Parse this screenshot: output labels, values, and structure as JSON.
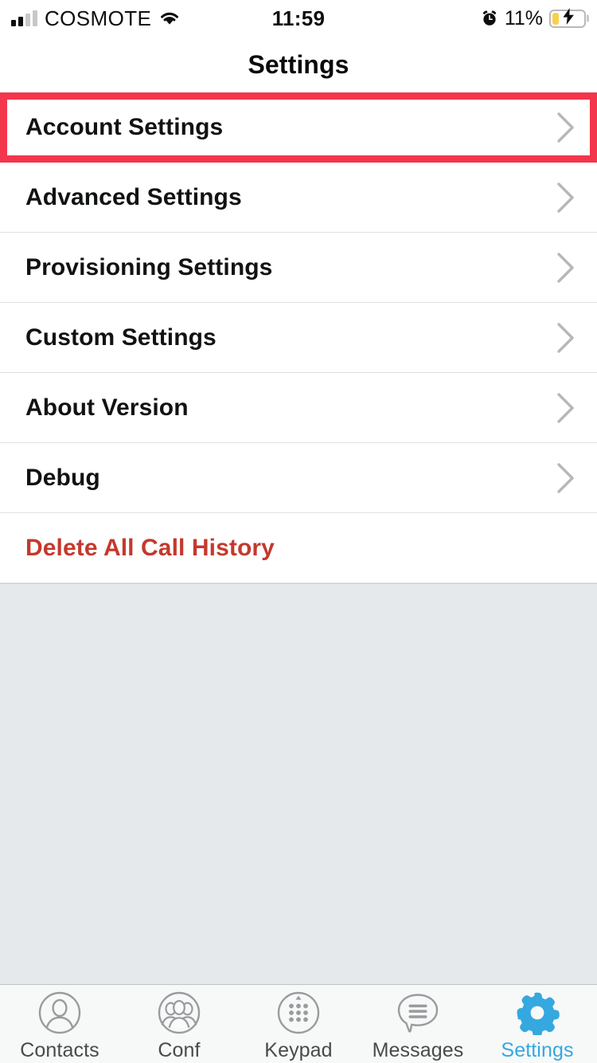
{
  "status_bar": {
    "carrier": "COSMOTE",
    "signal_bars_filled": 2,
    "signal_bars_total": 4,
    "wifi_icon": "wifi-icon",
    "time": "11:59",
    "alarm_icon": "alarm-clock-icon",
    "battery_percent": "11%",
    "battery_level": 11,
    "battery_charging": true,
    "battery_color": "#F7D14B"
  },
  "navbar": {
    "title": "Settings"
  },
  "highlight": {
    "color": "#F4364C",
    "target": "Account Settings"
  },
  "colors": {
    "accent_blue": "#35A8E0",
    "destructive_red": "#C4392D",
    "page_background": "#E6E9EB",
    "row_background": "#FFFFFF",
    "separator": "#DFE0E2"
  },
  "list": {
    "rows": [
      {
        "label": "Account Settings",
        "chevron": true,
        "style": "normal",
        "highlighted": true
      },
      {
        "label": "Advanced Settings",
        "chevron": true,
        "style": "normal",
        "highlighted": false
      },
      {
        "label": "Provisioning Settings",
        "chevron": true,
        "style": "normal",
        "highlighted": false
      },
      {
        "label": "Custom Settings",
        "chevron": true,
        "style": "normal",
        "highlighted": false
      },
      {
        "label": "About Version",
        "chevron": true,
        "style": "normal",
        "highlighted": false
      },
      {
        "label": "Debug",
        "chevron": true,
        "style": "normal",
        "highlighted": false
      },
      {
        "label": "Delete All Call History",
        "chevron": false,
        "style": "destructive",
        "highlighted": false
      }
    ]
  },
  "tabbar": {
    "items": [
      {
        "label": "Contacts",
        "icon": "contact-person-icon",
        "active": false
      },
      {
        "label": "Conf",
        "icon": "conference-group-icon",
        "active": false
      },
      {
        "label": "Keypad",
        "icon": "keypad-dots-icon",
        "active": false
      },
      {
        "label": "Messages",
        "icon": "message-bubble-icon",
        "active": false
      },
      {
        "label": "Settings",
        "icon": "gear-icon",
        "active": true
      }
    ]
  }
}
